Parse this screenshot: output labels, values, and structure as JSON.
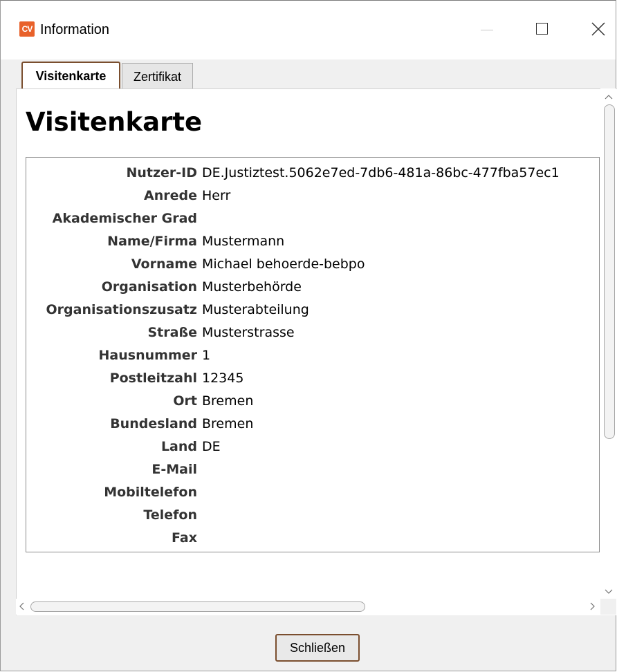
{
  "window": {
    "title": "Information",
    "logo_text": "CV",
    "controls": [
      "minimize-icon",
      "maximize-icon",
      "close-icon"
    ]
  },
  "tabs": [
    {
      "label": "Visitenkarte",
      "active": true
    },
    {
      "label": "Zertifikat",
      "active": false
    }
  ],
  "card": {
    "heading": "Visitenkarte",
    "rows": [
      {
        "label": "Nutzer-ID",
        "value": "DE.Justiztest.5062e7ed-7db6-481a-86bc-477fba57ec1"
      },
      {
        "label": "Anrede",
        "value": "Herr"
      },
      {
        "label": "Akademischer Grad",
        "value": ""
      },
      {
        "label": "Name/Firma",
        "value": "Mustermann"
      },
      {
        "label": "Vorname",
        "value": "Michael behoerde-bebpo"
      },
      {
        "label": "Organisation",
        "value": "Musterbehörde"
      },
      {
        "label": "Organisationszusatz",
        "value": "Musterabteilung"
      },
      {
        "label": "Straße",
        "value": "Musterstrasse"
      },
      {
        "label": "Hausnummer",
        "value": "1"
      },
      {
        "label": "Postleitzahl",
        "value": "12345"
      },
      {
        "label": "Ort",
        "value": "Bremen"
      },
      {
        "label": "Bundesland",
        "value": "Bremen"
      },
      {
        "label": "Land",
        "value": "DE"
      },
      {
        "label": "E-Mail",
        "value": ""
      },
      {
        "label": "Mobiltelefon",
        "value": ""
      },
      {
        "label": "Telefon",
        "value": ""
      },
      {
        "label": "Fax",
        "value": ""
      }
    ]
  },
  "footer": {
    "close_label": "Schließen"
  },
  "colors": {
    "logo": "#e8612a",
    "focus_border": "#7a4e2e",
    "label_text": "#333333"
  }
}
